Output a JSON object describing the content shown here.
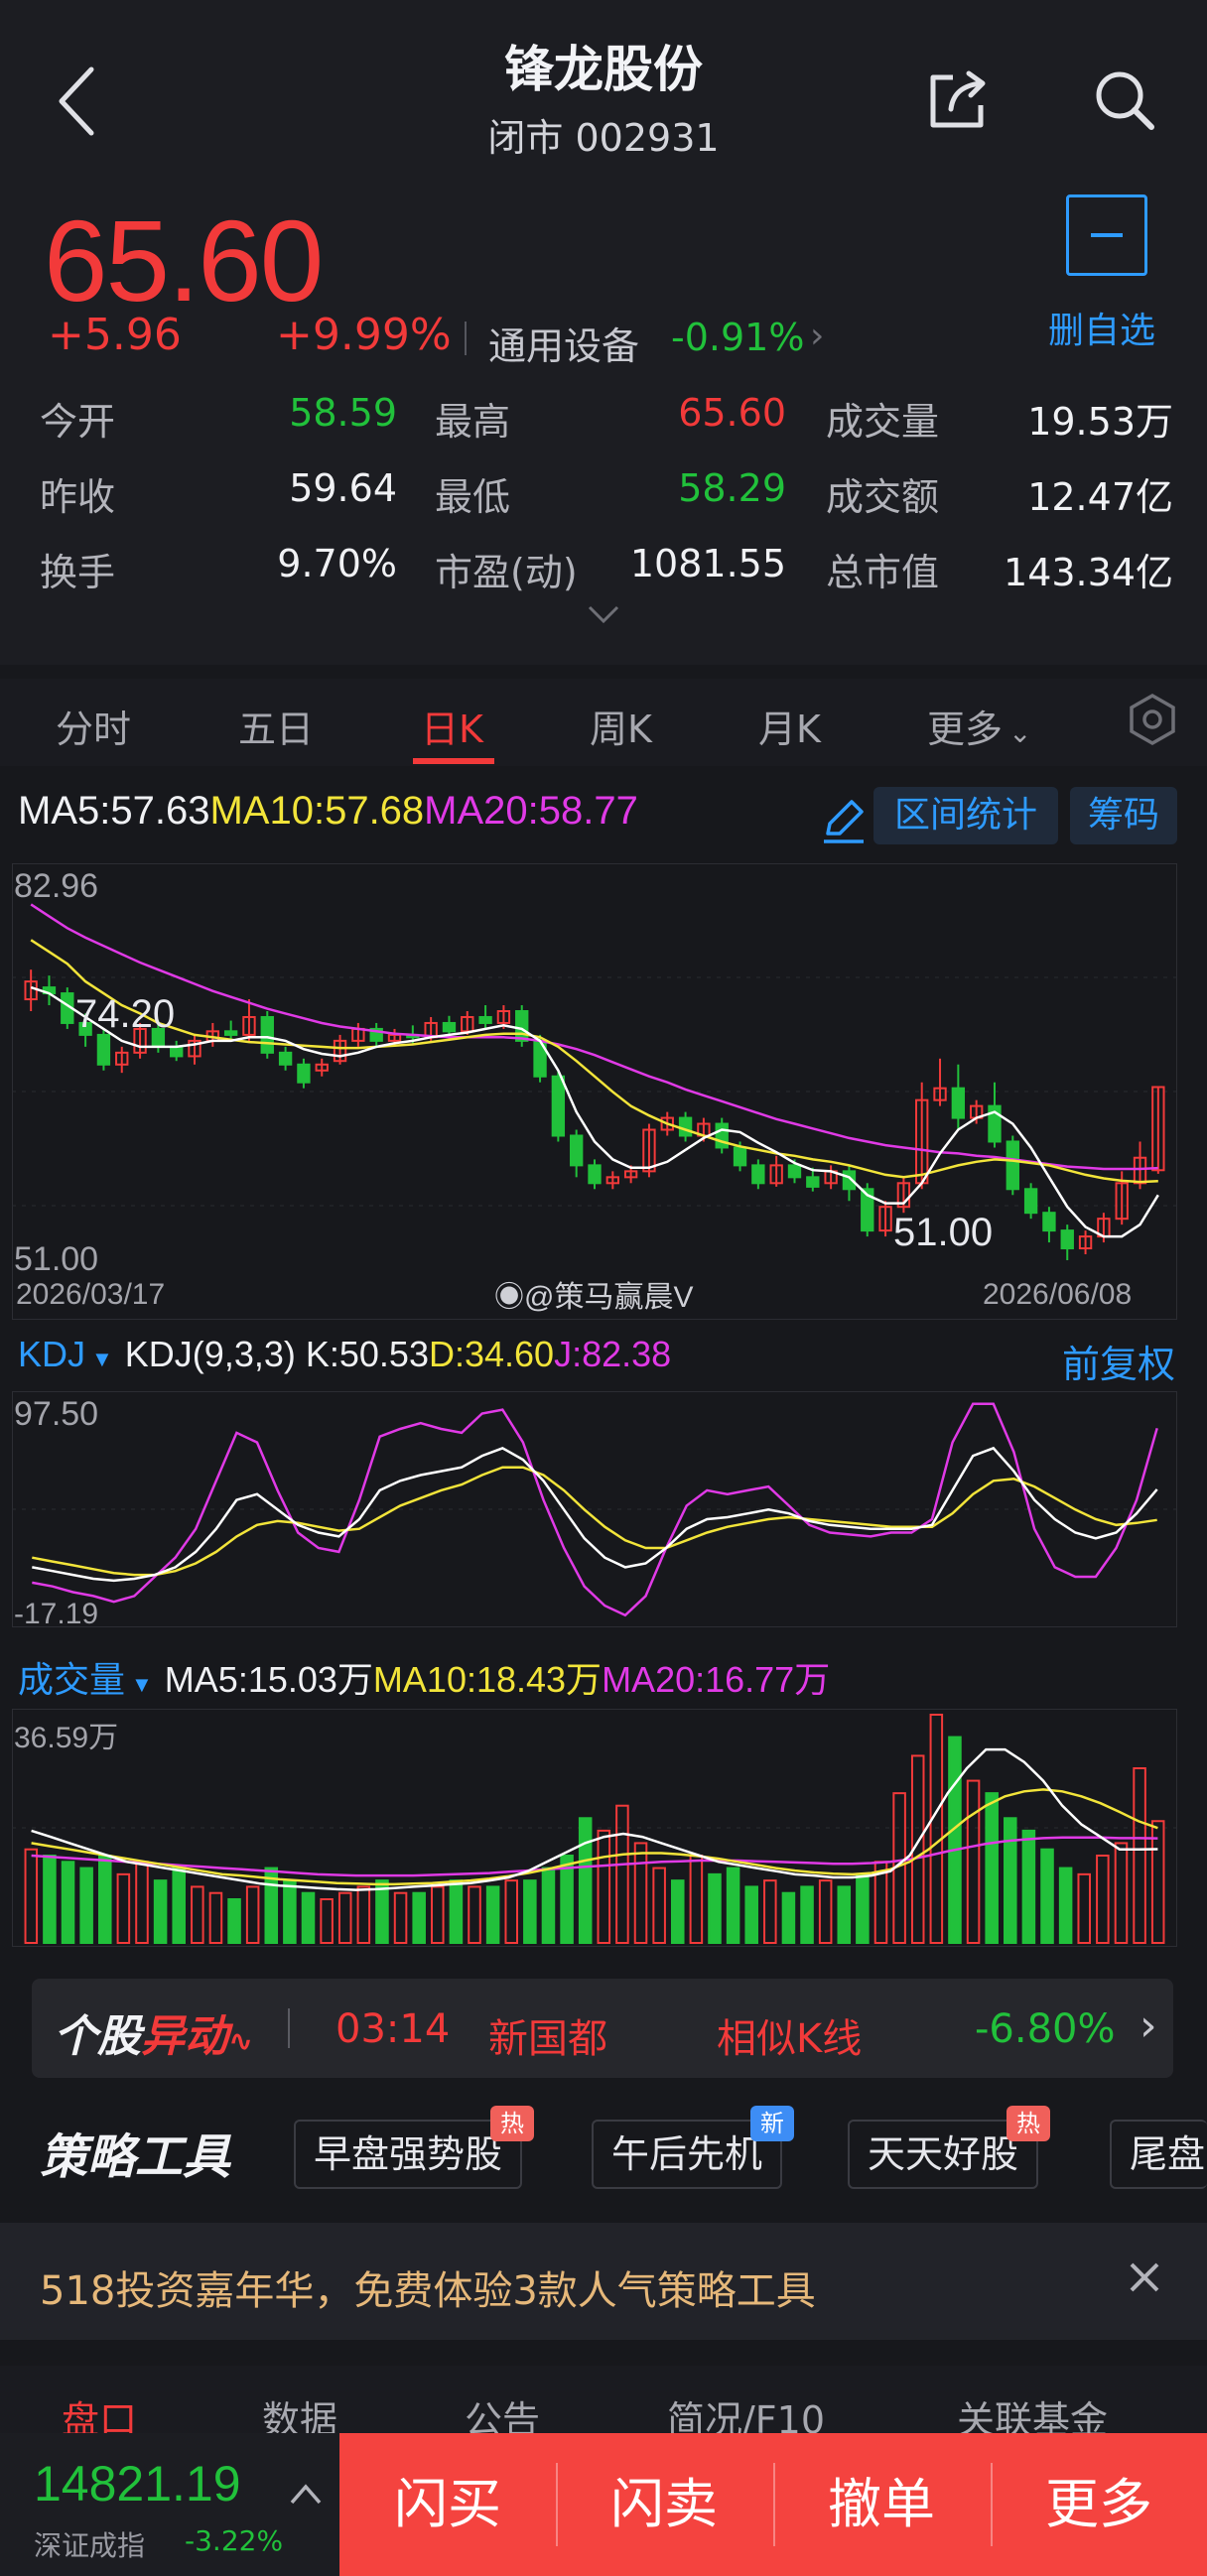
{
  "header": {
    "title": "锋龙股份",
    "subtitle": "闭市 002931"
  },
  "quote": {
    "price": "65.60",
    "change": "+5.96",
    "change_pct": "+9.99%",
    "sector": "通用设备",
    "sector_pct": "-0.91%",
    "fav_label": "删自选",
    "stats": [
      [
        {
          "label": "今开",
          "value": "58.59",
          "tone": "green"
        },
        {
          "label": "最高",
          "value": "65.60",
          "tone": "red"
        },
        {
          "label": "成交量",
          "value": "19.53万",
          "tone": "white"
        }
      ],
      [
        {
          "label": "昨收",
          "value": "59.64",
          "tone": "white"
        },
        {
          "label": "最低",
          "value": "58.29",
          "tone": "green"
        },
        {
          "label": "成交额",
          "value": "12.47亿",
          "tone": "white"
        }
      ],
      [
        {
          "label": "换手",
          "value": "9.70%",
          "tone": "white"
        },
        {
          "label": "市盈(动)",
          "value": "1081.55",
          "tone": "white"
        },
        {
          "label": "总市值",
          "value": "143.34亿",
          "tone": "white"
        }
      ]
    ]
  },
  "tabs": {
    "items": [
      "分时",
      "五日",
      "日K",
      "周K",
      "月K",
      "更多"
    ],
    "active": "日K"
  },
  "kline": {
    "ma5": "MA5:57.63",
    "ma10": "MA10:57.68",
    "ma20": "MA20:58.77",
    "range_button": "区间统计",
    "chip_button": "筹码",
    "y_max": "82.96",
    "y_min": "51.00",
    "hi_label": "74.20",
    "lo_label": "51.00",
    "date_start": "2026/03/17",
    "date_end": "2026/06/08",
    "watermark": "@策马赢晨V"
  },
  "kdj": {
    "name": "KDJ",
    "params": "KDJ(9,3,3)",
    "k": "K:50.53",
    "d": "D:34.60",
    "j": "J:82.38",
    "adjust": "前复权",
    "y_max": "97.50",
    "y_min": "-17.19"
  },
  "volume": {
    "name": "成交量",
    "ma5": "MA5:15.03万",
    "ma10": "MA10:18.43万",
    "ma20": "MA20:16.77万",
    "y_max": "36.59万"
  },
  "banner": {
    "logo_a": "个股",
    "logo_b": "异动",
    "time": "03:14",
    "name": "新国都",
    "tag": "相似K线",
    "pct": "-6.80%"
  },
  "strategy": {
    "title": "策略工具",
    "chips": [
      {
        "label": "早盘强势股",
        "badge": "热",
        "badge_color": "#f0605a"
      },
      {
        "label": "午后先机",
        "badge": "新",
        "badge_color": "#3d8df5"
      },
      {
        "label": "天天好股",
        "badge": "热",
        "badge_color": "#f0605a"
      },
      {
        "label": "尾盘",
        "badge": "",
        "badge_color": ""
      }
    ]
  },
  "promo": {
    "text": "518投资嘉年华，免费体验3款人气策略工具"
  },
  "bottom_tabs": [
    "盘口",
    "数据",
    "公告",
    "简况/F10",
    "关联基金"
  ],
  "footer": {
    "index_value": "14821.19",
    "index_name": "深证成指",
    "index_pct": "-3.22%",
    "actions": [
      "闪买",
      "闪卖",
      "撤单",
      "更多"
    ]
  },
  "chart_data": [
    {
      "type": "candlestick",
      "title": "日K",
      "x_start": "2026/03/17",
      "x_end": "2026/06/08",
      "ylim": [
        51.0,
        82.96
      ],
      "candles": [
        {
          "o": 73.0,
          "c": 74.5,
          "h": 75.5,
          "l": 72.0
        },
        {
          "o": 74.0,
          "c": 73.5,
          "h": 75.0,
          "l": 72.5
        },
        {
          "o": 73.5,
          "c": 71.0,
          "h": 74.0,
          "l": 70.5
        },
        {
          "o": 71.0,
          "c": 70.0,
          "h": 71.8,
          "l": 69.0
        },
        {
          "o": 70.0,
          "c": 67.5,
          "h": 70.5,
          "l": 67.0
        },
        {
          "o": 67.5,
          "c": 68.5,
          "h": 69.0,
          "l": 66.8
        },
        {
          "o": 68.5,
          "c": 70.5,
          "h": 71.0,
          "l": 68.0
        },
        {
          "o": 70.5,
          "c": 69.0,
          "h": 71.2,
          "l": 68.5
        },
        {
          "o": 69.0,
          "c": 68.2,
          "h": 69.5,
          "l": 67.8
        },
        {
          "o": 68.2,
          "c": 69.5,
          "h": 70.0,
          "l": 67.5
        },
        {
          "o": 69.5,
          "c": 70.3,
          "h": 71.0,
          "l": 69.0
        },
        {
          "o": 70.3,
          "c": 70.0,
          "h": 71.2,
          "l": 69.5
        },
        {
          "o": 70.0,
          "c": 71.5,
          "h": 73.0,
          "l": 69.5
        },
        {
          "o": 71.5,
          "c": 68.5,
          "h": 72.0,
          "l": 68.0
        },
        {
          "o": 68.5,
          "c": 67.5,
          "h": 69.0,
          "l": 67.0
        },
        {
          "o": 67.5,
          "c": 66.0,
          "h": 68.0,
          "l": 65.5
        },
        {
          "o": 67.0,
          "c": 67.5,
          "h": 68.0,
          "l": 66.5
        },
        {
          "o": 67.8,
          "c": 69.5,
          "h": 70.0,
          "l": 67.5
        },
        {
          "o": 69.5,
          "c": 70.5,
          "h": 71.0,
          "l": 69.0
        },
        {
          "o": 70.5,
          "c": 69.5,
          "h": 71.0,
          "l": 69.0
        },
        {
          "o": 69.5,
          "c": 70.0,
          "h": 70.5,
          "l": 69.0
        },
        {
          "o": 70.0,
          "c": 69.8,
          "h": 70.8,
          "l": 69.2
        },
        {
          "o": 69.8,
          "c": 71.0,
          "h": 71.5,
          "l": 69.5
        },
        {
          "o": 71.0,
          "c": 70.3,
          "h": 71.6,
          "l": 69.8
        },
        {
          "o": 70.3,
          "c": 71.5,
          "h": 72.0,
          "l": 70.0
        },
        {
          "o": 71.5,
          "c": 71.0,
          "h": 72.5,
          "l": 70.5
        },
        {
          "o": 71.0,
          "c": 72.0,
          "h": 72.5,
          "l": 70.5
        },
        {
          "o": 72.0,
          "c": 69.5,
          "h": 72.5,
          "l": 69.0
        },
        {
          "o": 69.5,
          "c": 66.5,
          "h": 70.0,
          "l": 66.0
        },
        {
          "o": 66.5,
          "c": 61.5,
          "h": 67.0,
          "l": 61.0
        },
        {
          "o": 61.5,
          "c": 59.0,
          "h": 62.0,
          "l": 58.0
        },
        {
          "o": 59.0,
          "c": 57.5,
          "h": 59.5,
          "l": 57.0
        },
        {
          "o": 57.5,
          "c": 58.0,
          "h": 58.5,
          "l": 57.0
        },
        {
          "o": 58.0,
          "c": 58.5,
          "h": 59.0,
          "l": 57.5
        },
        {
          "o": 58.5,
          "c": 62.0,
          "h": 62.5,
          "l": 58.0
        },
        {
          "o": 62.0,
          "c": 63.0,
          "h": 63.5,
          "l": 61.5
        },
        {
          "o": 63.0,
          "c": 61.5,
          "h": 63.5,
          "l": 61.0
        },
        {
          "o": 61.5,
          "c": 62.5,
          "h": 63.0,
          "l": 61.0
        },
        {
          "o": 62.5,
          "c": 60.5,
          "h": 63.0,
          "l": 60.0
        },
        {
          "o": 60.5,
          "c": 59.0,
          "h": 61.0,
          "l": 58.5
        },
        {
          "o": 59.0,
          "c": 57.5,
          "h": 59.5,
          "l": 57.0
        },
        {
          "o": 57.5,
          "c": 59.0,
          "h": 59.8,
          "l": 57.2
        },
        {
          "o": 59.0,
          "c": 58.0,
          "h": 59.5,
          "l": 57.5
        },
        {
          "o": 58.0,
          "c": 57.2,
          "h": 58.8,
          "l": 56.8
        },
        {
          "o": 57.5,
          "c": 58.5,
          "h": 59.0,
          "l": 57.0
        },
        {
          "o": 58.5,
          "c": 57.0,
          "h": 59.0,
          "l": 56.0
        },
        {
          "o": 57.0,
          "c": 53.5,
          "h": 57.5,
          "l": 53.0
        },
        {
          "o": 53.5,
          "c": 55.5,
          "h": 56.0,
          "l": 53.0
        },
        {
          "o": 55.5,
          "c": 57.5,
          "h": 58.0,
          "l": 55.0
        },
        {
          "o": 57.5,
          "c": 64.5,
          "h": 66.0,
          "l": 57.0
        },
        {
          "o": 64.5,
          "c": 65.5,
          "h": 68.0,
          "l": 64.0
        },
        {
          "o": 65.5,
          "c": 63.0,
          "h": 67.5,
          "l": 62.0
        },
        {
          "o": 63.0,
          "c": 64.0,
          "h": 64.5,
          "l": 62.5
        },
        {
          "o": 64.0,
          "c": 61.0,
          "h": 66.0,
          "l": 60.5
        },
        {
          "o": 61.0,
          "c": 57.0,
          "h": 61.5,
          "l": 56.5
        },
        {
          "o": 57.0,
          "c": 55.0,
          "h": 57.5,
          "l": 54.5
        },
        {
          "o": 55.0,
          "c": 53.5,
          "h": 55.5,
          "l": 52.5
        },
        {
          "o": 53.5,
          "c": 52.0,
          "h": 54.0,
          "l": 51.0
        },
        {
          "o": 52.0,
          "c": 53.0,
          "h": 53.5,
          "l": 51.5
        },
        {
          "o": 53.0,
          "c": 54.5,
          "h": 55.0,
          "l": 52.5
        },
        {
          "o": 54.5,
          "c": 57.5,
          "h": 58.5,
          "l": 54.0
        },
        {
          "o": 57.5,
          "c": 59.64,
          "h": 61.0,
          "l": 57.0
        },
        {
          "o": 58.59,
          "c": 65.6,
          "h": 65.6,
          "l": 58.29
        }
      ],
      "ma5": [
        74,
        73.5,
        72.5,
        71.5,
        70.5,
        69.5,
        69,
        69,
        69,
        69.2,
        69.5,
        69.5,
        69.8,
        69.8,
        69.5,
        68.8,
        68.4,
        68.2,
        68.5,
        69,
        69.3,
        69.5,
        69.8,
        70,
        70.2,
        70.5,
        70.8,
        70.5,
        69.5,
        67,
        63.5,
        61,
        59.5,
        58.8,
        58.8,
        59.3,
        60.3,
        61.3,
        62,
        61.8,
        60.9,
        60.1,
        59.2,
        58.6,
        58.5,
        58,
        56.5,
        55.8,
        55.8,
        57.5,
        60,
        62,
        63,
        63.5,
        62.5,
        60.5,
        58,
        55.5,
        53.8,
        53,
        53,
        54,
        56.5
      ],
      "ma10": [
        78,
        77,
        76,
        74.5,
        73.5,
        72.5,
        71.8,
        71,
        70.5,
        70,
        69.8,
        69.6,
        69.4,
        69.3,
        69.2,
        69.1,
        69,
        68.9,
        68.9,
        69,
        69.1,
        69.2,
        69.4,
        69.6,
        69.8,
        70,
        70.1,
        70.1,
        69.8,
        69,
        67.8,
        66.5,
        65.2,
        64,
        63.2,
        62.5,
        62,
        61.5,
        61,
        60.6,
        60.3,
        60,
        59.8,
        59.5,
        59.3,
        59,
        58.6,
        58.2,
        58,
        58.2,
        58.6,
        59,
        59.3,
        59.5,
        59.4,
        59.2,
        59,
        58.6,
        58.2,
        57.9,
        57.7,
        57.6,
        57.68
      ],
      "ma20": [
        81,
        80,
        79,
        78.2,
        77.5,
        76.8,
        76.1,
        75.5,
        74.9,
        74.3,
        73.7,
        73.2,
        72.7,
        72.2,
        71.8,
        71.4,
        71,
        70.7,
        70.5,
        70.3,
        70.1,
        70,
        69.9,
        69.8,
        69.8,
        69.8,
        69.8,
        69.7,
        69.5,
        69.2,
        68.8,
        68.3,
        67.7,
        67.1,
        66.5,
        66,
        65.4,
        64.9,
        64.4,
        63.9,
        63.4,
        62.9,
        62.5,
        62.1,
        61.7,
        61.3,
        61,
        60.7,
        60.5,
        60.3,
        60.1,
        60,
        59.8,
        59.7,
        59.5,
        59.3,
        59.1,
        58.9,
        58.8,
        58.7,
        58.7,
        58.7,
        58.77
      ]
    },
    {
      "type": "line",
      "title": "KDJ(9,3,3)",
      "ylim": [
        -17.19,
        97.5
      ],
      "series": [
        {
          "name": "K",
          "values": [
            10,
            8,
            6,
            4,
            3,
            4,
            6,
            10,
            18,
            30,
            45,
            48,
            40,
            32,
            28,
            26,
            35,
            50,
            55,
            58,
            60,
            62,
            68,
            72,
            66,
            55,
            40,
            25,
            15,
            10,
            12,
            20,
            30,
            35,
            36,
            38,
            40,
            38,
            34,
            32,
            31,
            30,
            30,
            30,
            32,
            50,
            68,
            72,
            60,
            45,
            35,
            28,
            25,
            28,
            38,
            50.53
          ]
        },
        {
          "name": "D",
          "values": [
            15,
            13,
            11,
            9,
            7,
            6,
            6,
            8,
            12,
            18,
            26,
            32,
            34,
            33,
            31,
            29,
            30,
            36,
            42,
            46,
            50,
            53,
            58,
            62,
            62,
            58,
            50,
            40,
            31,
            24,
            20,
            20,
            24,
            28,
            31,
            33,
            35,
            36,
            35,
            34,
            33,
            32,
            31,
            31,
            31,
            38,
            48,
            55,
            56,
            52,
            46,
            40,
            35,
            32,
            33,
            34.6
          ]
        },
        {
          "name": "J",
          "values": [
            2,
            0,
            -3,
            -5,
            -8,
            -5,
            5,
            15,
            30,
            55,
            80,
            75,
            50,
            28,
            20,
            18,
            45,
            78,
            82,
            85,
            82,
            80,
            90,
            92,
            75,
            45,
            20,
            0,
            -10,
            -15,
            -5,
            20,
            42,
            50,
            48,
            50,
            52,
            42,
            32,
            28,
            27,
            26,
            28,
            28,
            35,
            75,
            95,
            95,
            70,
            30,
            10,
            5,
            5,
            20,
            45,
            82.38
          ]
        }
      ]
    },
    {
      "type": "bar",
      "title": "成交量",
      "ylim": [
        0,
        36.59
      ],
      "unit": "万",
      "series": [
        {
          "name": "volume",
          "values": [
            15,
            14,
            13,
            12,
            14,
            11,
            13,
            10,
            12,
            9,
            8,
            7,
            9,
            12,
            10,
            8,
            7,
            8,
            9,
            10,
            8,
            8,
            9,
            10,
            9,
            9,
            10,
            10,
            12,
            14,
            20,
            18,
            22,
            16,
            12,
            10,
            14,
            11,
            12,
            9,
            10,
            8,
            9,
            10,
            9,
            11,
            13,
            24,
            30,
            36.59,
            33,
            26,
            24,
            20,
            18,
            15,
            12,
            11,
            14,
            16,
            28,
            19.53
          ]
        },
        {
          "name": "MA5",
          "values": [
            18,
            17,
            16,
            15,
            14,
            13,
            12.5,
            12,
            11.5,
            11,
            10.5,
            10,
            9.5,
            9.2,
            9,
            8.8,
            8.6,
            8.5,
            8.6,
            8.8,
            9,
            9.2,
            9.4,
            9.6,
            10,
            10.5,
            11.5,
            13,
            14.5,
            16,
            17,
            17.5,
            17,
            16,
            15,
            14,
            13,
            12.5,
            12,
            11.5,
            11,
            10.8,
            10.5,
            10.5,
            10.8,
            11.5,
            14,
            19,
            24,
            28,
            31,
            31,
            29,
            26,
            22,
            19,
            17,
            15,
            15,
            15.03
          ]
        },
        {
          "name": "MA10",
          "values": [
            16,
            15.5,
            15,
            14.5,
            14,
            13.5,
            13,
            12.5,
            12,
            11.5,
            11,
            10.8,
            10.5,
            10.2,
            10,
            9.8,
            9.6,
            9.5,
            9.4,
            9.4,
            9.5,
            9.6,
            9.8,
            10,
            10.3,
            10.7,
            11.2,
            11.8,
            12.5,
            13.2,
            13.8,
            14.2,
            14.4,
            14.4,
            14.2,
            13.9,
            13.5,
            13,
            12.5,
            12,
            11.6,
            11.3,
            11.1,
            11,
            11.2,
            11.8,
            13,
            15,
            17.5,
            20,
            22,
            23.5,
            24.3,
            24.6,
            24.3,
            23.5,
            22.4,
            21,
            19.5,
            18.43
          ]
        },
        {
          "name": "MA20",
          "values": [
            14,
            13.8,
            13.6,
            13.4,
            13.2,
            13,
            12.8,
            12.6,
            12.4,
            12.2,
            12,
            11.8,
            11.6,
            11.4,
            11.2,
            11,
            10.9,
            10.8,
            10.8,
            10.8,
            10.8,
            10.9,
            11,
            11.1,
            11.2,
            11.4,
            11.6,
            11.8,
            12,
            12.2,
            12.4,
            12.6,
            12.8,
            13,
            13.1,
            13.2,
            13.2,
            13.2,
            13.1,
            13,
            12.9,
            12.8,
            12.7,
            12.7,
            12.8,
            13,
            13.4,
            14,
            14.7,
            15.3,
            15.9,
            16.3,
            16.6,
            16.8,
            16.9,
            16.9,
            16.9,
            16.8,
            16.8,
            16.77
          ]
        }
      ]
    }
  ]
}
